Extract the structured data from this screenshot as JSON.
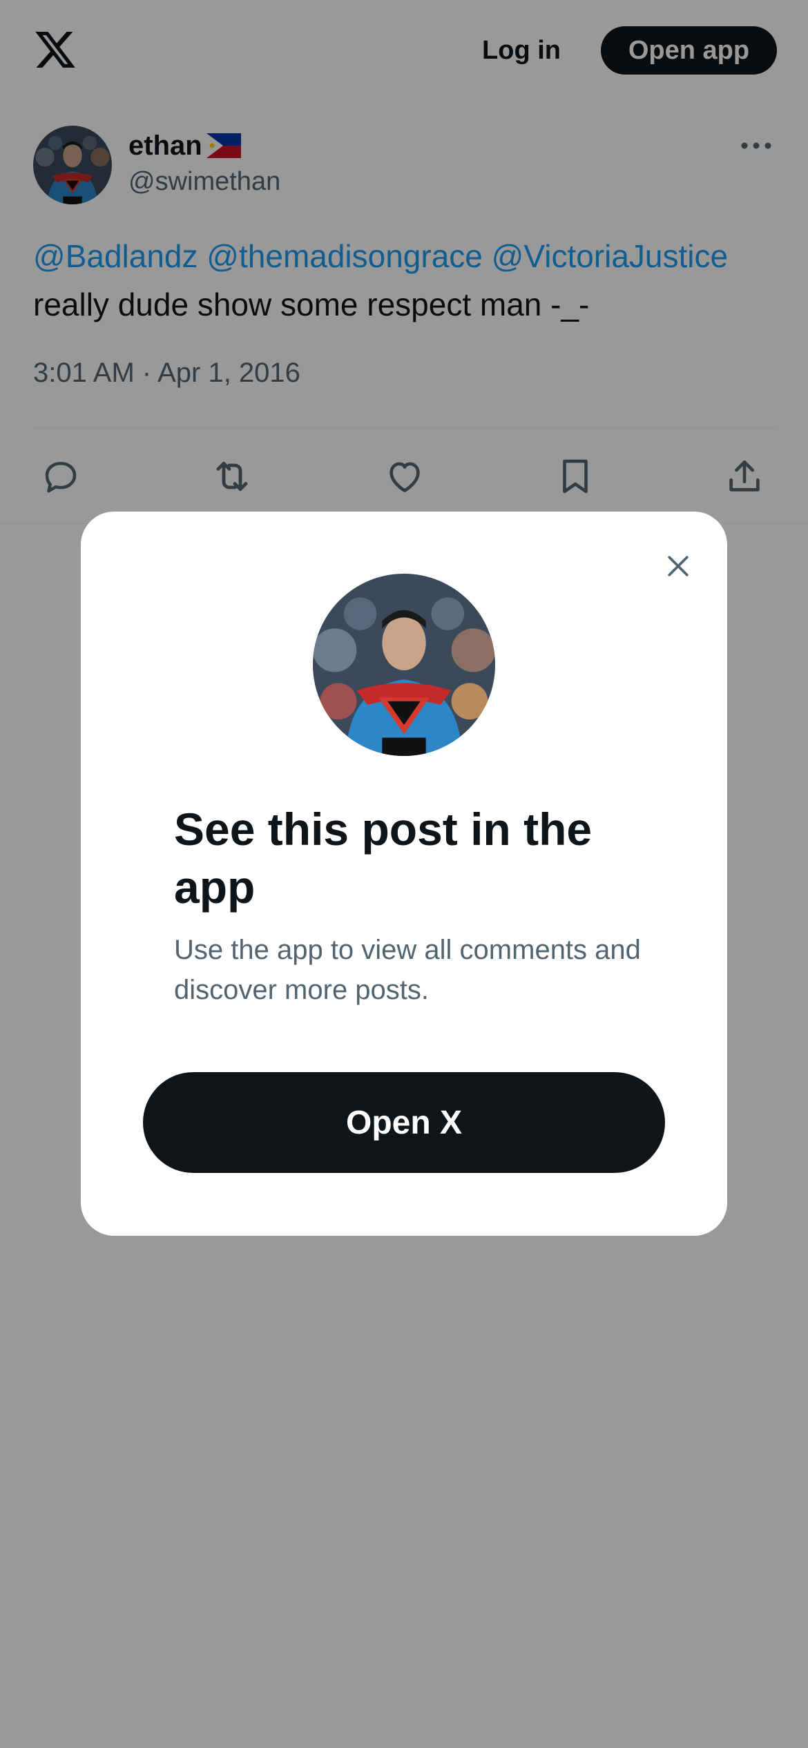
{
  "header": {
    "logo_icon": "x-logo-icon",
    "login_label": "Log in",
    "open_app_label": "Open app"
  },
  "tweet": {
    "display_name": "ethan",
    "flag_icon": "philippines-flag-icon",
    "handle": "@swimethan",
    "mentions": [
      "@Badlandz",
      "@themadisongrace",
      "@VictoriaJustice"
    ],
    "text": "really dude show some respect man -_-",
    "timestamp": "3:01 AM · Apr 1, 2016",
    "actions": [
      "reply-icon",
      "repost-icon",
      "like-icon",
      "bookmark-icon",
      "share-icon"
    ]
  },
  "modal": {
    "title": "See this post in the app",
    "subtitle": "Use the app to view all comments and discover more posts.",
    "button_label": "Open X",
    "close_icon": "close-icon"
  },
  "colors": {
    "primary_text": "#0f1419",
    "secondary_text": "#536471",
    "link": "#1d9bf0",
    "button_dark": "#0f1419",
    "overlay": "rgba(0,0,0,0.40)"
  }
}
